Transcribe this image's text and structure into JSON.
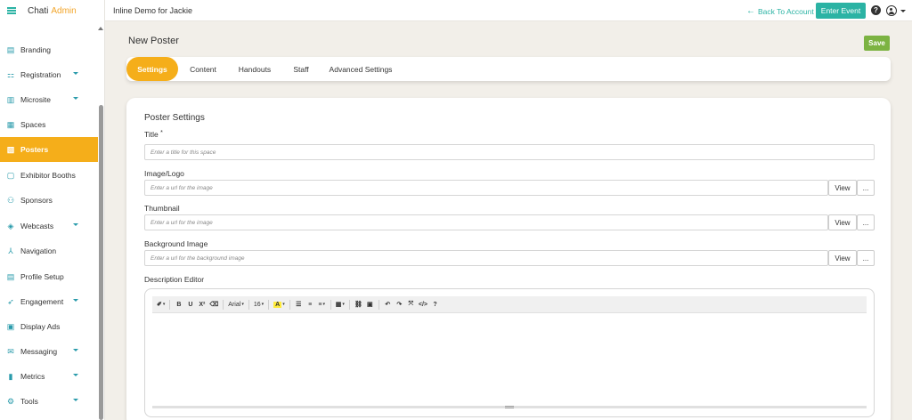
{
  "brand": {
    "name": "Chati",
    "suffix": "Admin"
  },
  "sidebar": {
    "items": [
      {
        "label": "Branding",
        "icon": "branding-icon",
        "caret": false,
        "active": false
      },
      {
        "label": "Registration",
        "icon": "registration-icon",
        "caret": true,
        "active": false
      },
      {
        "label": "Microsite",
        "icon": "microsite-icon",
        "caret": true,
        "active": false
      },
      {
        "label": "Spaces",
        "icon": "spaces-icon",
        "caret": false,
        "active": false
      },
      {
        "label": "Posters",
        "icon": "posters-icon",
        "caret": false,
        "active": true
      },
      {
        "label": "Exhibitor Booths",
        "icon": "booth-icon",
        "caret": false,
        "active": false
      },
      {
        "label": "Sponsors",
        "icon": "sponsors-icon",
        "caret": false,
        "active": false
      },
      {
        "label": "Webcasts",
        "icon": "webcasts-icon",
        "caret": true,
        "active": false
      },
      {
        "label": "Navigation",
        "icon": "navigation-icon",
        "caret": false,
        "active": false
      },
      {
        "label": "Profile Setup",
        "icon": "profile-icon",
        "caret": false,
        "active": false
      },
      {
        "label": "Engagement",
        "icon": "engagement-icon",
        "caret": true,
        "active": false
      },
      {
        "label": "Display Ads",
        "icon": "ads-icon",
        "caret": false,
        "active": false
      },
      {
        "label": "Messaging",
        "icon": "messaging-icon",
        "caret": true,
        "active": false
      },
      {
        "label": "Metrics",
        "icon": "metrics-icon",
        "caret": true,
        "active": false
      },
      {
        "label": "Tools",
        "icon": "tools-icon",
        "caret": true,
        "active": false
      }
    ]
  },
  "header": {
    "event_name": "Inline Demo for Jackie",
    "back_label": "Back To Account",
    "enter_label": "Enter Event",
    "help_glyph": "?"
  },
  "page": {
    "title": "New Poster",
    "save_label": "Save"
  },
  "tabs": [
    {
      "label": "Settings",
      "active": true
    },
    {
      "label": "Content",
      "active": false
    },
    {
      "label": "Handouts",
      "active": false
    },
    {
      "label": "Staff",
      "active": false
    },
    {
      "label": "Advanced Settings",
      "active": false
    }
  ],
  "form": {
    "section_title": "Poster Settings",
    "title_label": "Title",
    "required_mark": "*",
    "title_placeholder": "Enter a title for this space",
    "image_label": "Image/Logo",
    "image_placeholder": "Enter a url for the image",
    "thumbnail_label": "Thumbnail",
    "thumbnail_placeholder": "Enter a url for the image",
    "bg_label": "Background Image",
    "bg_placeholder": "Enter a url for the background image",
    "view_label": "View",
    "more_label": "...",
    "editor_label": "Description Editor"
  },
  "editor_toolbar": {
    "font_name": "Arial",
    "font_size": "16",
    "bold": "B",
    "underline": "U",
    "superscript": "X²",
    "color_letter": "A",
    "code": "</>",
    "help": "?"
  },
  "colors": {
    "accent": "#f5ae1a",
    "teal": "#2bb3a4",
    "save": "#7cb342"
  }
}
